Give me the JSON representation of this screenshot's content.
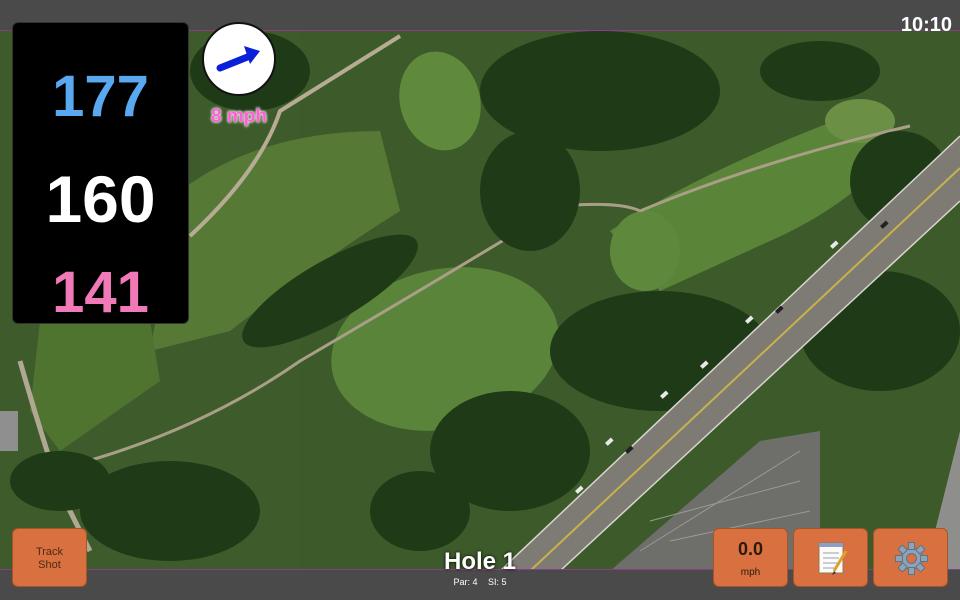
{
  "clock": "10:10",
  "distances": {
    "back": "177",
    "middle": "160",
    "front": "141"
  },
  "wind": {
    "speed_label": "8 mph",
    "icon": "wind-direction-arrow-icon"
  },
  "buttons": {
    "track_shot_line1": "Track",
    "track_shot_line2": "Shot",
    "speed_value": "0.0",
    "speed_unit": "mph",
    "notes_icon": "notepad-icon",
    "settings_icon": "gear-icon"
  },
  "hole": {
    "title": "Hole 1",
    "par": "Par: 4",
    "si": "SI: 5"
  },
  "colors": {
    "back": "#5aa8f0",
    "middle": "#ffffff",
    "front": "#f07ab8",
    "button": "#d9703f",
    "wind_label": "#ff5fd6"
  }
}
